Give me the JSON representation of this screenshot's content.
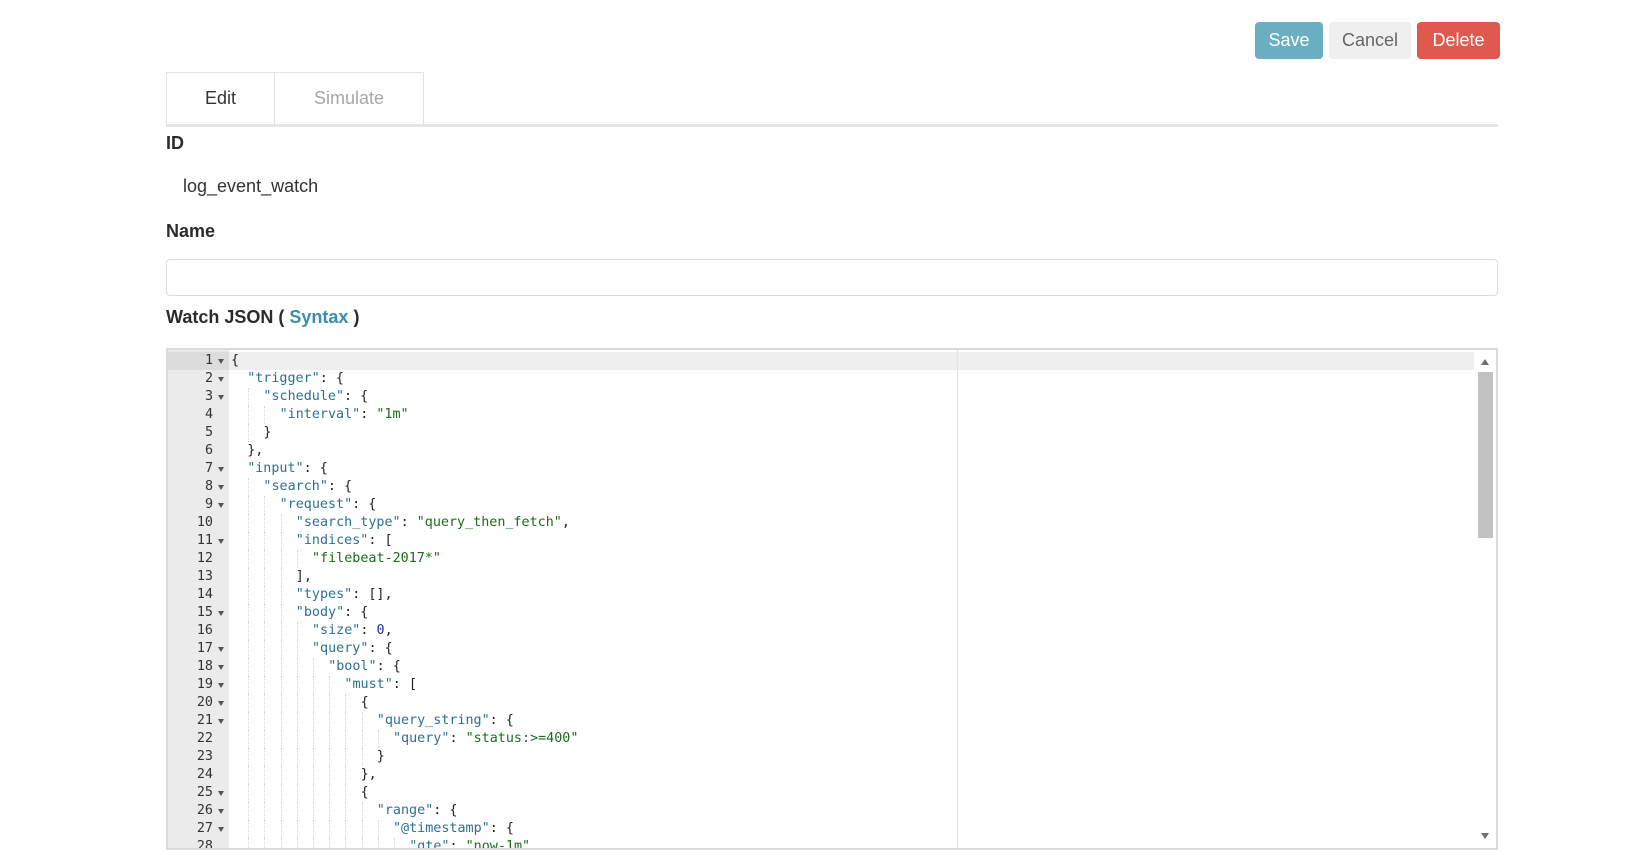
{
  "toolbar": {
    "save_label": "Save",
    "cancel_label": "Cancel",
    "delete_label": "Delete"
  },
  "tabs": [
    {
      "label": "Edit"
    },
    {
      "label": "Simulate"
    }
  ],
  "form": {
    "id_label": "ID",
    "id_value": "log_event_watch",
    "name_label": "Name",
    "name_value": "",
    "watch_json_label": "Watch JSON",
    "paren_open": "(",
    "syntax_link": "Syntax",
    "paren_close": ")"
  },
  "editor": {
    "active_line": 1,
    "lines": [
      {
        "num": 1,
        "indent": 0,
        "fold": true,
        "text": "{"
      },
      {
        "num": 2,
        "indent": 1,
        "fold": true,
        "text": "\"trigger\": {"
      },
      {
        "num": 3,
        "indent": 2,
        "fold": true,
        "text": "\"schedule\": {"
      },
      {
        "num": 4,
        "indent": 3,
        "fold": false,
        "text": "\"interval\": \"1m\""
      },
      {
        "num": 5,
        "indent": 2,
        "fold": false,
        "text": "}"
      },
      {
        "num": 6,
        "indent": 1,
        "fold": false,
        "text": "},"
      },
      {
        "num": 7,
        "indent": 1,
        "fold": true,
        "text": "\"input\": {"
      },
      {
        "num": 8,
        "indent": 2,
        "fold": true,
        "text": "\"search\": {"
      },
      {
        "num": 9,
        "indent": 3,
        "fold": true,
        "text": "\"request\": {"
      },
      {
        "num": 10,
        "indent": 4,
        "fold": false,
        "text": "\"search_type\": \"query_then_fetch\","
      },
      {
        "num": 11,
        "indent": 4,
        "fold": true,
        "text": "\"indices\": ["
      },
      {
        "num": 12,
        "indent": 5,
        "fold": false,
        "text": "\"filebeat-2017*\""
      },
      {
        "num": 13,
        "indent": 4,
        "fold": false,
        "text": "],"
      },
      {
        "num": 14,
        "indent": 4,
        "fold": false,
        "text": "\"types\": [],"
      },
      {
        "num": 15,
        "indent": 4,
        "fold": true,
        "text": "\"body\": {"
      },
      {
        "num": 16,
        "indent": 5,
        "fold": false,
        "text": "\"size\": 0,"
      },
      {
        "num": 17,
        "indent": 5,
        "fold": true,
        "text": "\"query\": {"
      },
      {
        "num": 18,
        "indent": 6,
        "fold": true,
        "text": "\"bool\": {"
      },
      {
        "num": 19,
        "indent": 7,
        "fold": true,
        "text": "\"must\": ["
      },
      {
        "num": 20,
        "indent": 8,
        "fold": true,
        "text": "{"
      },
      {
        "num": 21,
        "indent": 9,
        "fold": true,
        "text": "\"query_string\": {"
      },
      {
        "num": 22,
        "indent": 10,
        "fold": false,
        "text": "\"query\": \"status:>=400\""
      },
      {
        "num": 23,
        "indent": 9,
        "fold": false,
        "text": "}"
      },
      {
        "num": 24,
        "indent": 8,
        "fold": false,
        "text": "},"
      },
      {
        "num": 25,
        "indent": 8,
        "fold": true,
        "text": "{"
      },
      {
        "num": 26,
        "indent": 9,
        "fold": true,
        "text": "\"range\": {"
      },
      {
        "num": 27,
        "indent": 10,
        "fold": true,
        "text": "\"@timestamp\": {"
      },
      {
        "num": 28,
        "indent": 11,
        "fold": false,
        "text": "\"gte\": \"now-1m\""
      }
    ]
  }
}
